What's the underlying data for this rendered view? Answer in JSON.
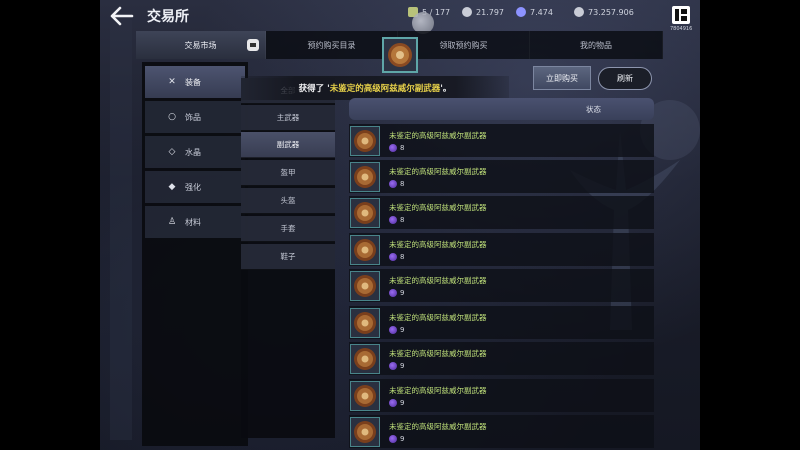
{
  "header": {
    "title": "交易所",
    "currencies": [
      {
        "icon": "inventory-icon",
        "value": "5 / 177",
        "color": "#b8c27a"
      },
      {
        "icon": "silver-coin-icon",
        "value": "21.797",
        "color": "#c9ccd6"
      },
      {
        "icon": "star-gem-icon",
        "value": "7.474",
        "color": "#8d93ff"
      },
      {
        "icon": "silver-icon",
        "value": "73.257.906",
        "color": "#c9ccd6"
      }
    ],
    "profile_id": "7804916"
  },
  "tabs": [
    {
      "label": "交易市场",
      "active": true
    },
    {
      "label": "预约购买目录",
      "active": false
    },
    {
      "label": "领取预约购买",
      "active": false
    },
    {
      "label": "我的物品",
      "active": false
    }
  ],
  "categories": [
    {
      "icon": "sword-cross-icon",
      "glyph": "✕",
      "label": "装备",
      "active": true
    },
    {
      "icon": "ring-icon",
      "glyph": "○",
      "label": "饰品",
      "active": false
    },
    {
      "icon": "crystal-icon",
      "glyph": "◇",
      "label": "水晶",
      "active": false
    },
    {
      "icon": "enhance-icon",
      "glyph": "◆",
      "label": "强化",
      "active": false
    },
    {
      "icon": "potion-icon",
      "glyph": "♙",
      "label": "材料",
      "active": false
    }
  ],
  "subcategories": [
    {
      "label": "全部",
      "active": false
    },
    {
      "label": "主武器",
      "active": false
    },
    {
      "label": "副武器",
      "active": true
    },
    {
      "label": "盔甲",
      "active": false
    },
    {
      "label": "头盔",
      "active": false
    },
    {
      "label": "手套",
      "active": false
    },
    {
      "label": "鞋子",
      "active": false
    }
  ],
  "toast": {
    "prefix": "获得了 '",
    "item": "未鉴定的高级阿兹威尔副武器",
    "suffix": "'。"
  },
  "actions": {
    "buy_now": "立即购买",
    "refresh": "刷新"
  },
  "list_header": {
    "status": "状态"
  },
  "items": [
    {
      "name": "未鉴定的高级阿兹威尔副武器",
      "enhance": "8"
    },
    {
      "name": "未鉴定的高级阿兹威尔副武器",
      "enhance": "8"
    },
    {
      "name": "未鉴定的高级阿兹威尔副武器",
      "enhance": "8"
    },
    {
      "name": "未鉴定的高级阿兹威尔副武器",
      "enhance": "8"
    },
    {
      "name": "未鉴定的高级阿兹威尔副武器",
      "enhance": "9"
    },
    {
      "name": "未鉴定的高级阿兹威尔副武器",
      "enhance": "9"
    },
    {
      "name": "未鉴定的高级阿兹威尔副武器",
      "enhance": "9"
    },
    {
      "name": "未鉴定的高级阿兹威尔副武器",
      "enhance": "9"
    },
    {
      "name": "未鉴定的高级阿兹威尔副武器",
      "enhance": "9"
    }
  ]
}
